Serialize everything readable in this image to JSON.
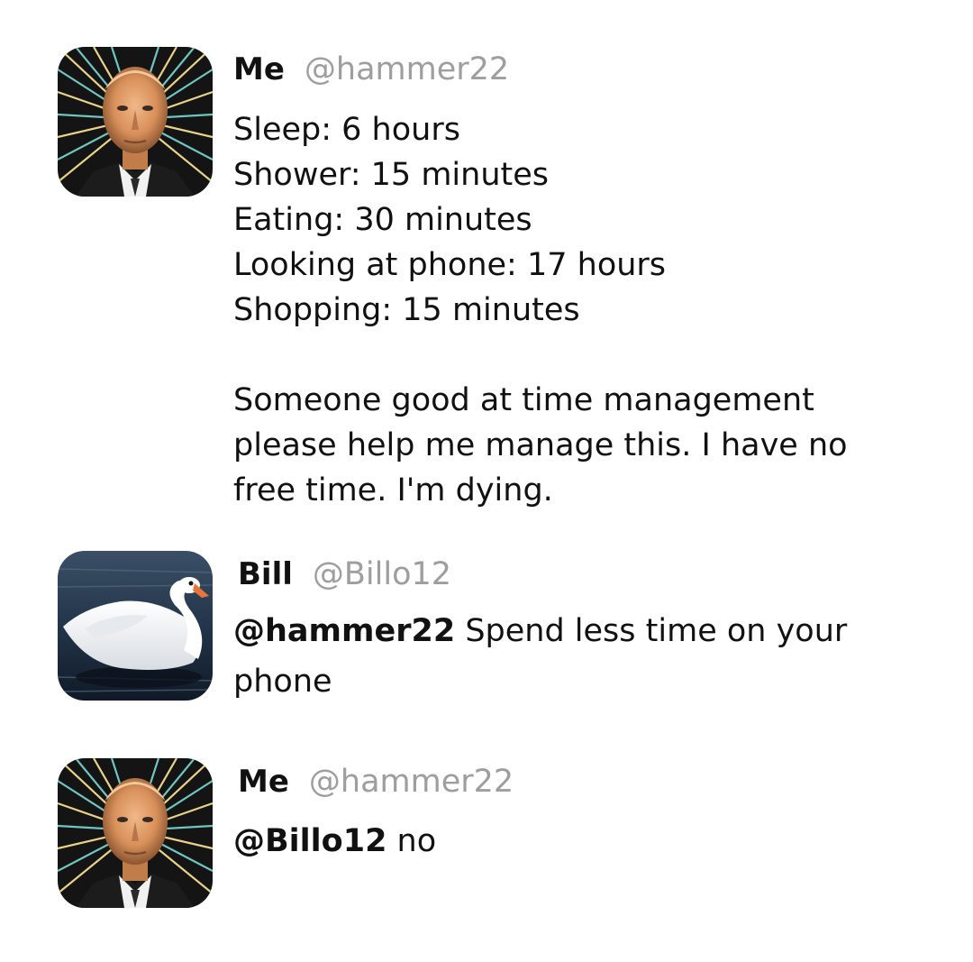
{
  "posts": [
    {
      "author": "Me",
      "handle": "@hammer22",
      "avatar_icon": "man-portrait-avatar",
      "lines": [
        "Sleep: 6 hours",
        "Shower: 15 minutes",
        "Eating: 30 minutes",
        "Looking at phone: 17 hours",
        "Shopping: 15 minutes",
        "",
        "Someone good at time management",
        "please help me manage this. I have no",
        "free time. I'm dying."
      ]
    },
    {
      "author": "Bill",
      "handle": "@Billo12",
      "avatar_icon": "swan-avatar",
      "mention": "@hammer22",
      "line1_rest": " Spend less time on your",
      "line2": "phone"
    },
    {
      "author": "Me",
      "handle": "@hammer22",
      "avatar_icon": "man-portrait-avatar",
      "mention": "@Billo12",
      "text": " no"
    }
  ],
  "colors": {
    "text": "#111111",
    "handle": "#9e9e9e",
    "background": "#ffffff"
  }
}
